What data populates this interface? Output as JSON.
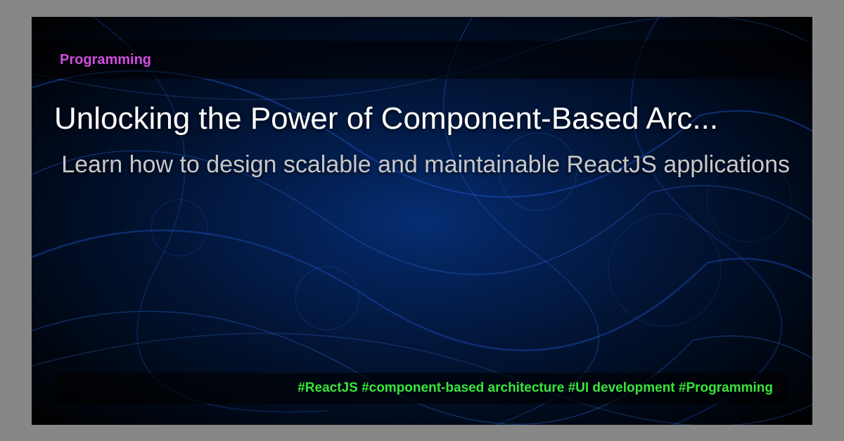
{
  "category": "Programming",
  "title": "Unlocking the Power of Component-Based Arc...",
  "subtitle": "Learn how to design scalable and maintainable ReactJS applications",
  "tags": "#ReactJS #component-based architecture #UI development #Programming"
}
